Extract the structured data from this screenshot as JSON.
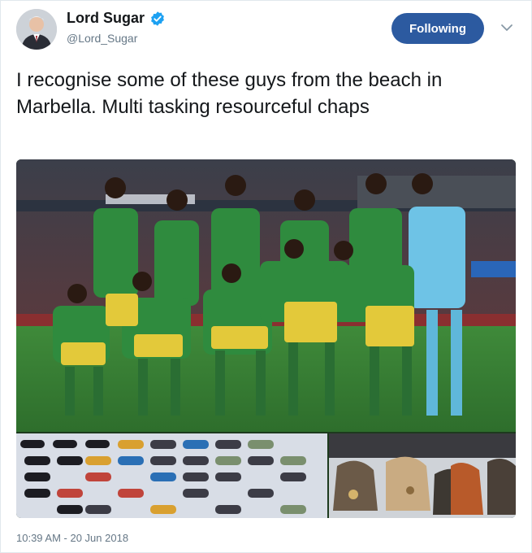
{
  "author": {
    "display_name": "Lord Sugar",
    "handle": "@Lord_Sugar",
    "verified": true,
    "avatar_icon": "user-avatar"
  },
  "actions": {
    "follow_label": "Following",
    "menu_icon": "chevron-down-icon"
  },
  "tweet": {
    "text": "I recognise some of these guys from the beach in Marbella. Multi tasking resourceful chaps",
    "timestamp": "10:39 AM - 20 Jun 2018"
  },
  "media": {
    "photos": [
      {
        "description_icon": "team-photo"
      },
      {
        "description_icon": "sunglasses-photo"
      },
      {
        "description_icon": "handbags-photo"
      }
    ]
  },
  "colors": {
    "follow_button": "#2c5aa0",
    "verified": "#1da1f2",
    "secondary_text": "#657786"
  }
}
